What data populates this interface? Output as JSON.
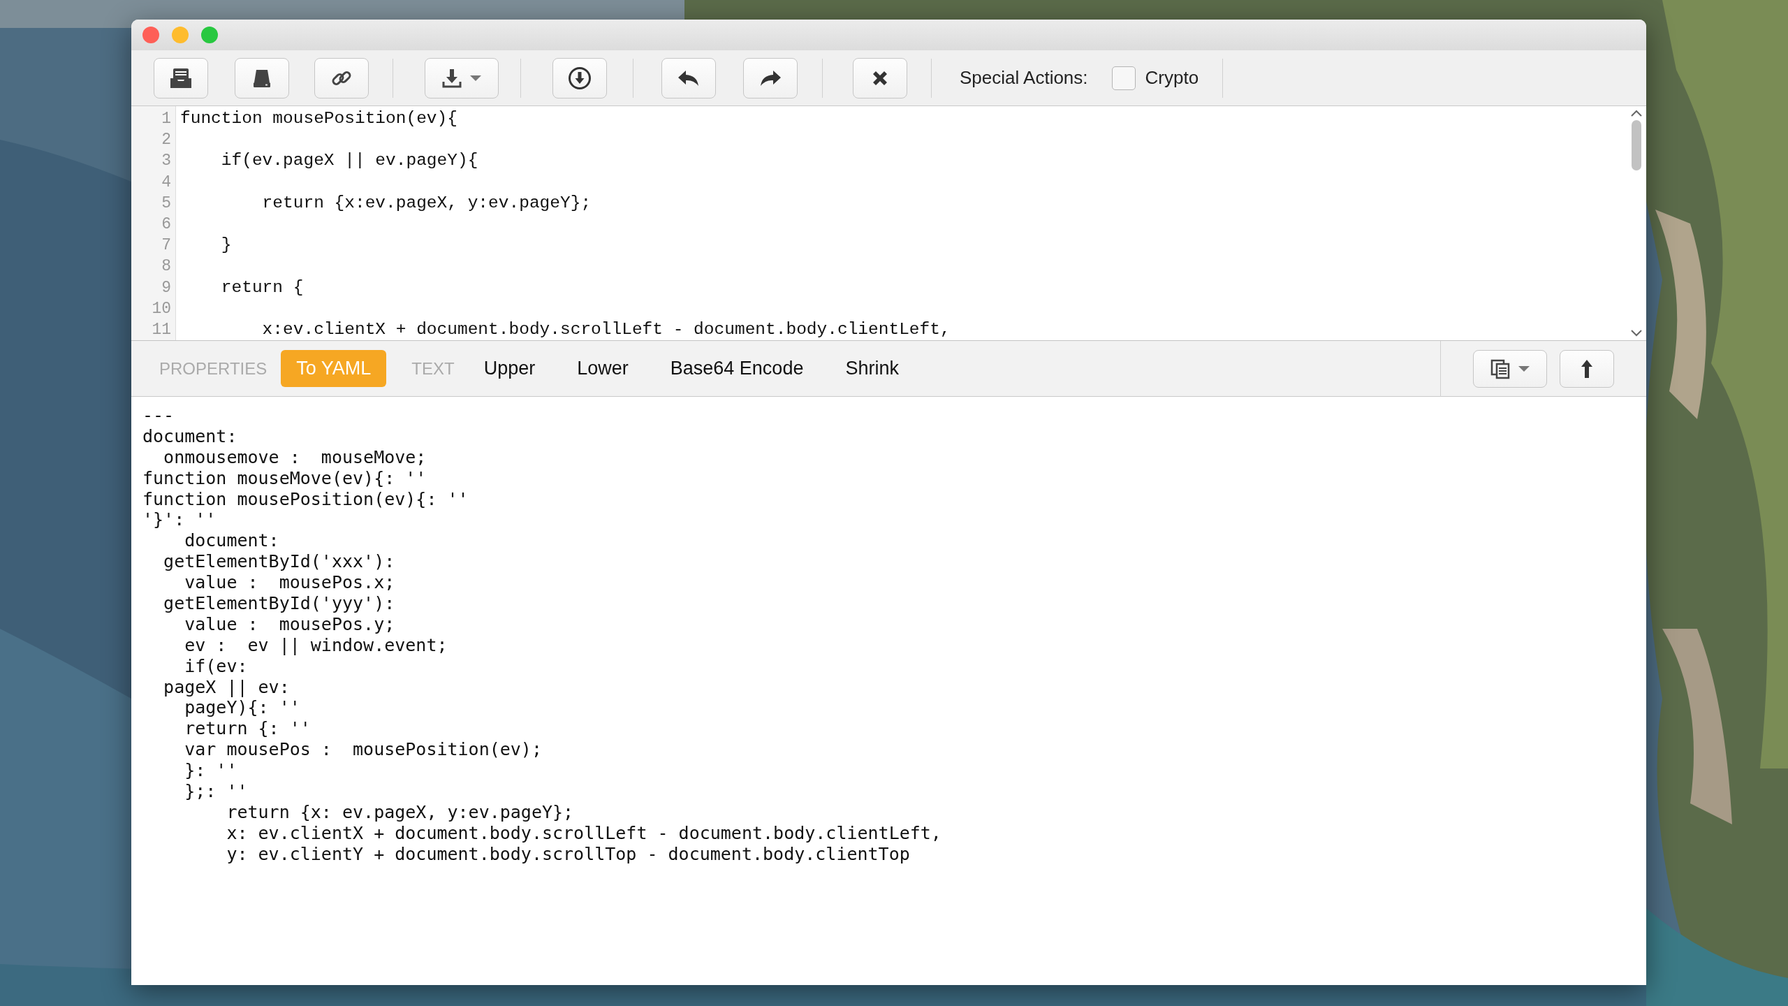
{
  "toolbar": {
    "special_actions_label": "Special Actions:",
    "crypto": {
      "label": "Crypto",
      "checked": false
    }
  },
  "editor": {
    "lines": [
      {
        "number": "1",
        "text": "function mousePosition(ev){"
      },
      {
        "number": "2"
      },
      {
        "number": "3",
        "text": "    if(ev.pageX || ev.pageY){"
      },
      {
        "number": "4"
      },
      {
        "number": "5",
        "text": "        return {x:ev.pageX, y:ev.pageY};"
      },
      {
        "number": "6"
      },
      {
        "number": "7",
        "text": "    }"
      },
      {
        "number": "8"
      },
      {
        "number": "9",
        "text": "    return {"
      },
      {
        "number": "10"
      },
      {
        "number": "11",
        "text": "        x:ev.clientX + document.body.scrollLeft - document.body.clientLeft,"
      }
    ]
  },
  "transform_bar": {
    "items": [
      {
        "kind": "header",
        "label": "PROPERTIES"
      },
      {
        "kind": "action",
        "label": "To YAML",
        "selected": true
      },
      {
        "kind": "header",
        "label": "TEXT"
      },
      {
        "kind": "action",
        "label": "Upper",
        "selected": false
      },
      {
        "kind": "action",
        "label": "Lower",
        "selected": false
      },
      {
        "kind": "action",
        "label": "Base64 Encode",
        "selected": false
      },
      {
        "kind": "action",
        "label": "Shrink",
        "selected": false
      }
    ]
  },
  "output": {
    "lines": [
      "---",
      "document:",
      "  onmousemove :  mouseMove;",
      "function mouseMove(ev){: ''",
      "function mousePosition(ev){: ''",
      "'}': ''",
      "    document:",
      "  getElementById('xxx'):",
      "    value :  mousePos.x;",
      "  getElementById('yyy'):",
      "    value :  mousePos.y;",
      "    ev :  ev || window.event;",
      "    if(ev:",
      "  pageX || ev:",
      "    pageY){: ''",
      "    return {: ''",
      "    var mousePos :  mousePosition(ev);",
      "    }: ''",
      "    };: ''",
      "        return {x: ev.pageX, y:ev.pageY};",
      "        x: ev.clientX + document.body.scrollLeft - document.body.clientLeft,",
      "        y: ev.clientY + document.body.scrollTop - document.body.clientTop"
    ]
  }
}
